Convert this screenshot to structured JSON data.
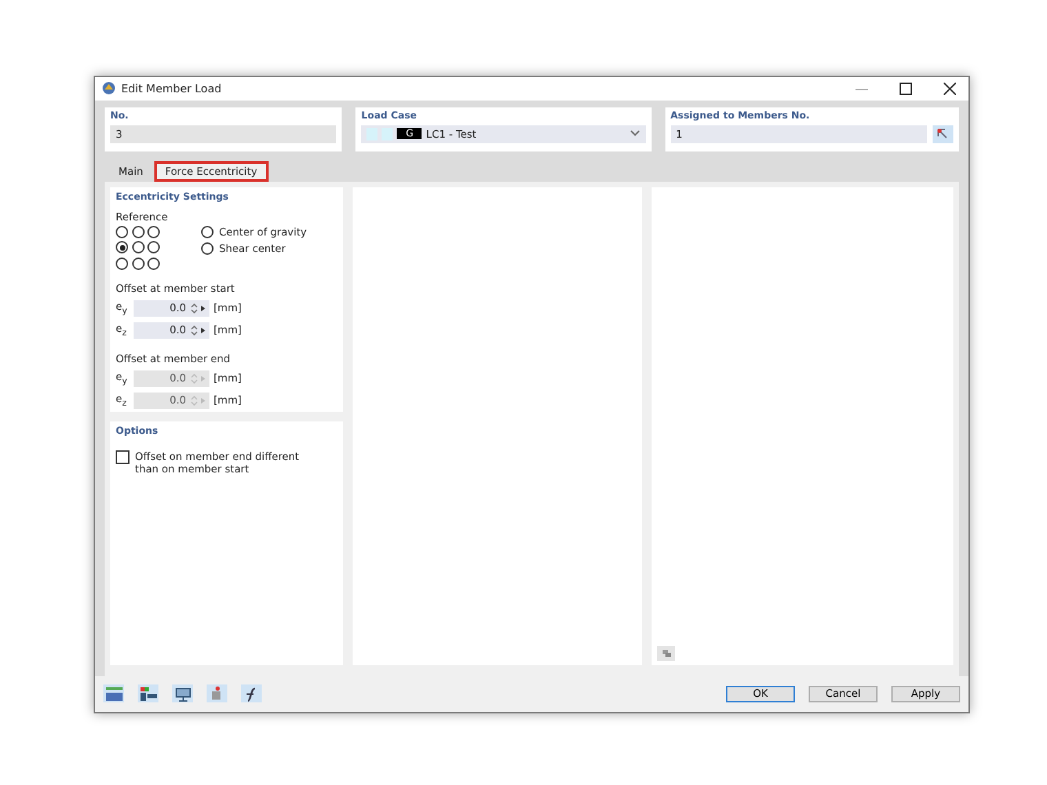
{
  "window": {
    "title": "Edit Member Load"
  },
  "header": {
    "number": {
      "label": "No.",
      "value": "3"
    },
    "load_case": {
      "label": "Load Case",
      "badge": "G",
      "value": "LC1 - Test"
    },
    "assigned": {
      "label": "Assigned to Members No.",
      "value": "1"
    }
  },
  "tabs": [
    {
      "label": "Main",
      "selected": false
    },
    {
      "label": "Force Eccentricity",
      "selected": true
    }
  ],
  "eccentricity": {
    "title": "Eccentricity Settings",
    "reference_label": "Reference",
    "grid": [
      {
        "selected": false
      },
      {
        "selected": false
      },
      {
        "selected": false
      },
      {
        "selected": true
      },
      {
        "selected": false
      },
      {
        "selected": false
      },
      {
        "selected": false
      },
      {
        "selected": false
      },
      {
        "selected": false
      }
    ],
    "reference_options": [
      {
        "label": "Center of gravity",
        "selected": false
      },
      {
        "label": "Shear center",
        "selected": false
      }
    ],
    "groups": [
      {
        "title": "Offset at member start",
        "disabled": false,
        "rows": [
          {
            "symbol": "e$_{y}$",
            "value": "0.0",
            "unit": "[mm]"
          },
          {
            "symbol": "e$_{z}$",
            "value": "0.0",
            "unit": "[mm]"
          }
        ]
      },
      {
        "title": "Offset at member end",
        "disabled": true,
        "rows": [
          {
            "symbol": "e$_{y}$",
            "value": "0.0",
            "unit": "[mm]"
          },
          {
            "symbol": "e$_{z}$",
            "value": "0.0",
            "unit": "[mm]"
          }
        ]
      }
    ]
  },
  "options": {
    "title": "Options",
    "checkboxes": [
      {
        "label": "Offset on member end different than on member start",
        "checked": false
      }
    ]
  },
  "buttons": [
    {
      "label": "OK",
      "default": true
    },
    {
      "label": "Cancel",
      "default": false
    },
    {
      "label": "Apply",
      "default": false
    }
  ]
}
